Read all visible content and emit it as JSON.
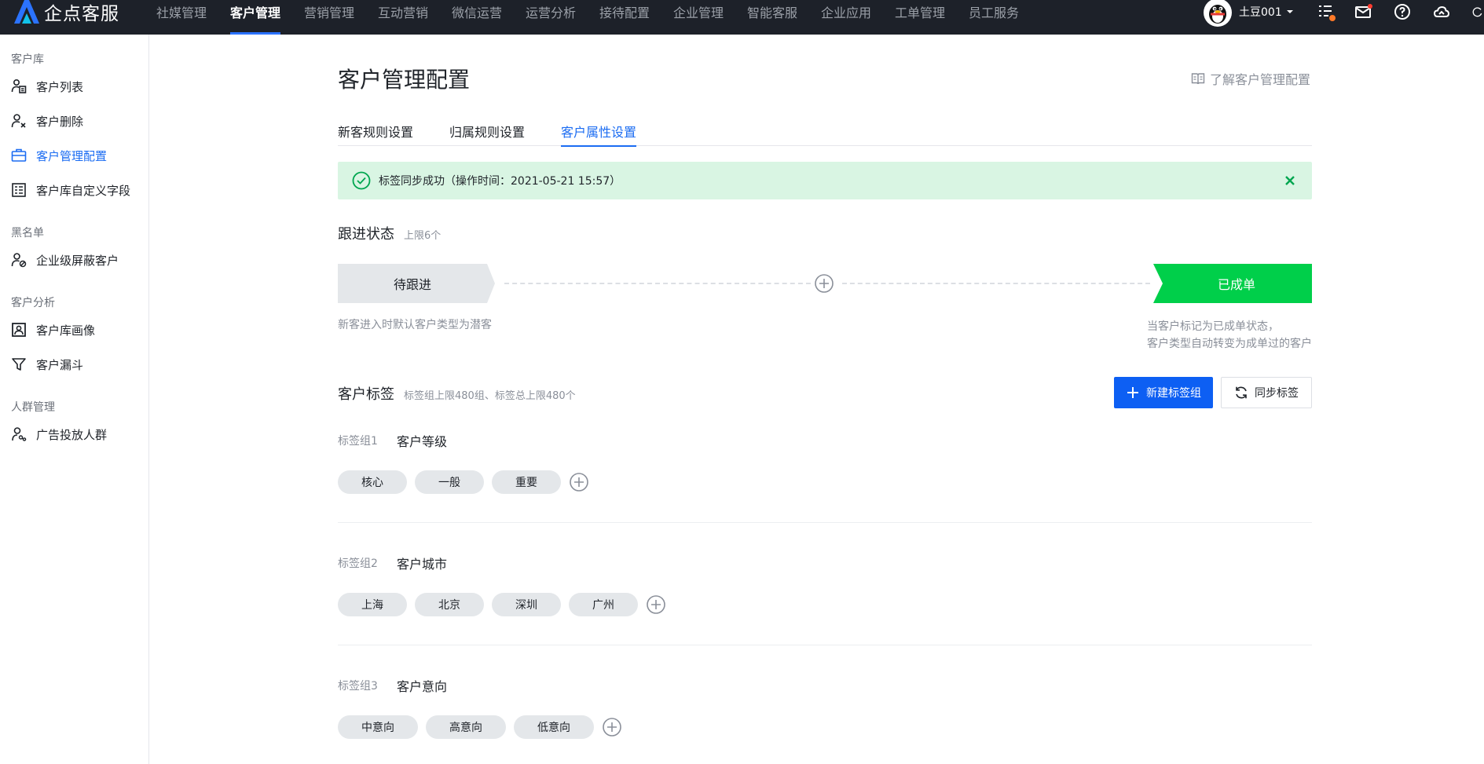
{
  "app": {
    "brand": "企点客服",
    "nav": [
      "社媒管理",
      "客户管理",
      "营销管理",
      "互动营销",
      "微信运营",
      "运营分析",
      "接待配置",
      "企业管理",
      "智能客服",
      "企业应用",
      "工单管理",
      "员工服务"
    ],
    "active_nav": "客户管理",
    "user_name": "土豆001"
  },
  "sidebar": {
    "sections": [
      {
        "title": "客户库",
        "items": [
          {
            "label": "客户列表",
            "icon": "customer-list-icon"
          },
          {
            "label": "客户删除",
            "icon": "user-remove-icon"
          },
          {
            "label": "客户管理配置",
            "icon": "briefcase-icon",
            "active": true
          },
          {
            "label": "客户库自定义字段",
            "icon": "form-fields-icon"
          }
        ]
      },
      {
        "title": "黑名单",
        "items": [
          {
            "label": "企业级屏蔽客户",
            "icon": "user-block-icon"
          }
        ]
      },
      {
        "title": "客户分析",
        "items": [
          {
            "label": "客户库画像",
            "icon": "portrait-frame-icon"
          },
          {
            "label": "客户漏斗",
            "icon": "funnel-icon"
          }
        ]
      },
      {
        "title": "人群管理",
        "items": [
          {
            "label": "广告投放人群",
            "icon": "audience-icon"
          }
        ]
      }
    ]
  },
  "main": {
    "title": "客户管理配置",
    "help_link": "了解客户管理配置",
    "tabs": [
      "新客规则设置",
      "归属规则设置",
      "客户属性设置"
    ],
    "active_tab": "客户属性设置",
    "alert": {
      "message": "标签同步成功（操作时间：2021-05-21 15:57）",
      "color": "#d9f5e3"
    },
    "follow": {
      "title": "跟进状态",
      "hint": "上限6个",
      "start_stage": "待跟进",
      "end_stage": "已成单",
      "start_note": "新客进入时默认客户类型为潜客",
      "end_note_line1": "当客户标记为已成单状态，",
      "end_note_line2": "客户类型自动转变为成单过的客户"
    },
    "tags": {
      "title": "客户标签",
      "hint": "标签组上限480组、标签总上限480个",
      "new_group_button": "新建标签组",
      "sync_button": "同步标签",
      "groups": [
        {
          "index": "标签组1",
          "name": "客户等级",
          "chips": [
            "核心",
            "一般",
            "重要"
          ]
        },
        {
          "index": "标签组2",
          "name": "客户城市",
          "chips": [
            "上海",
            "北京",
            "深圳",
            "广州"
          ]
        },
        {
          "index": "标签组3",
          "name": "客户意向",
          "chips": [
            "中意向",
            "高意向",
            "低意向"
          ]
        }
      ]
    }
  },
  "colors": {
    "primary": "#0d5ff3",
    "success": "#00c853",
    "nav_bg": "#1d2129"
  }
}
